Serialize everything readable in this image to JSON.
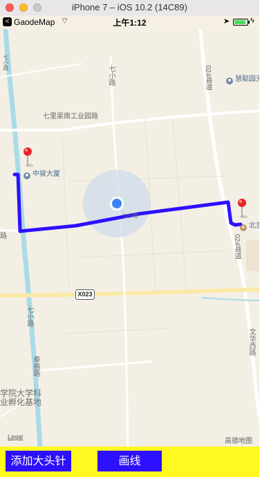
{
  "simulator": {
    "title": "iPhone 7 – iOS 10.2 (14C89)"
  },
  "status_bar": {
    "back_glyph": "<",
    "back_app": "GaodeMap",
    "wifi_glyph": "⌔",
    "time": "上午1:12",
    "location_glyph": "➤",
    "bolt_glyph": "ϟ",
    "battery_percent": 90,
    "battery_color": "#4cd964"
  },
  "map": {
    "labels": {
      "qixiqu_road": "七里渠南工业园路",
      "qixiao_road": "七小路",
      "county_road_024": "024县道",
      "county_road_024_b": "024县道",
      "x023": "X023",
      "wenhua_west_road": "文华西路",
      "left_road": "路",
      "top_left_road": "七小路",
      "lower_road": "七小路",
      "ji_road": "泰格路",
      "center_road": "七小路"
    },
    "pois": {
      "zhongjun": "中骏大厦",
      "huicong": "慧聪园天",
      "bei": "北京",
      "college_line1": "学院大学科",
      "college_line2": "业孵化基地"
    },
    "legal": "Legal",
    "logo": "高德地图",
    "route_color": "#2d10ff",
    "location_dot_color": "#3b82f6"
  },
  "toolbar": {
    "add_pin_label": "添加大头针",
    "draw_line_label": "画线",
    "background_color": "#fff91f",
    "button_color": "#2d10ff"
  }
}
